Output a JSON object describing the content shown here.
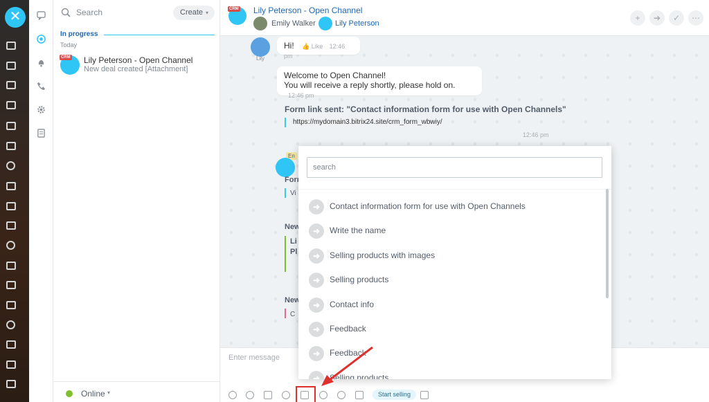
{
  "window": {
    "close_glyph": "✕"
  },
  "list": {
    "search_placeholder": "Search",
    "create_label": "Create",
    "section": "In progress",
    "today": "Today",
    "items": [
      {
        "badge": "CRM",
        "name": "Lily Peterson - Open Channel",
        "sub": "New deal created [Attachment]"
      }
    ],
    "status": "Online"
  },
  "chat": {
    "badge": "CRM",
    "title": "Lily Peterson - Open Channel",
    "user1": "Emily Walker",
    "user2": "Lily Peterson",
    "sender": "Lily",
    "msg1": {
      "text": "Hi!",
      "like": "Like",
      "time": "12:46 pm"
    },
    "msg2": {
      "line1": "Welcome to Open Channel!",
      "line2": "You will receive a reply shortly, please hold on.",
      "time": "12:46 pm"
    },
    "form": {
      "title": "Form link sent: \"Contact information form for use with Open Channels\"",
      "link": "https://mydomain3.bitrix24.site/crm_form_wbwiy/",
      "time": "12:46 pm"
    },
    "partials": {
      "en": "En",
      "form": "Forn",
      "vi": "Vi",
      "new1": "New",
      "li": "Li",
      "pl": "Pl",
      "new2": "New",
      "c": "C"
    },
    "input_placeholder": "Enter message",
    "start_selling": "Start selling"
  },
  "dropdown": {
    "search_placeholder": "search",
    "items": [
      "Contact information form for use with Open Channels",
      "Write the name",
      "Selling products with images",
      "Selling products",
      "Contact info",
      "Feedback",
      "Feedback",
      "Selling products"
    ]
  },
  "colors": {
    "accent": "#2fc6f6",
    "link": "#2067b0",
    "highlight": "#e0302d",
    "online": "#7fc02f"
  }
}
